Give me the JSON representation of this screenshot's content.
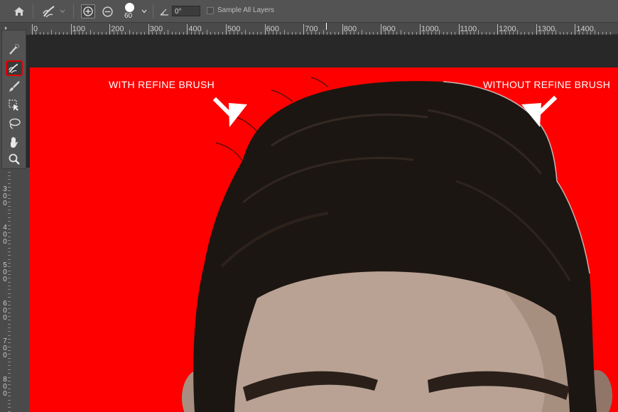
{
  "options_bar": {
    "brush_size": "60",
    "angle_value": "0°",
    "sample_all_layers_label": "Sample All Layers"
  },
  "ruler_horizontal": [
    "0",
    "100",
    "200",
    "300",
    "400",
    "500",
    "600",
    "700",
    "800",
    "900",
    "1000",
    "1100",
    "1200",
    "1300",
    "1400"
  ],
  "ruler_vertical": [
    {
      "text": "3"
    },
    {
      "text": "0"
    },
    {
      "text": "0"
    },
    {
      "text": "4"
    },
    {
      "text": "0"
    },
    {
      "text": "0"
    },
    {
      "text": "5"
    },
    {
      "text": "0"
    },
    {
      "text": "0"
    },
    {
      "text": "6"
    },
    {
      "text": "0"
    },
    {
      "text": "0"
    },
    {
      "text": "7"
    },
    {
      "text": "0"
    },
    {
      "text": "0"
    },
    {
      "text": "8"
    },
    {
      "text": "0"
    },
    {
      "text": "0"
    }
  ],
  "annotations": {
    "with_refine": "WITH REFINE BRUSH",
    "without_refine": "WITHOUT REFINE BRUSH"
  },
  "colors": {
    "canvas_background": "#ff0000",
    "selected_tool_outline": "#e00000",
    "hair": "#1c1612",
    "skin": "#b9a294"
  }
}
